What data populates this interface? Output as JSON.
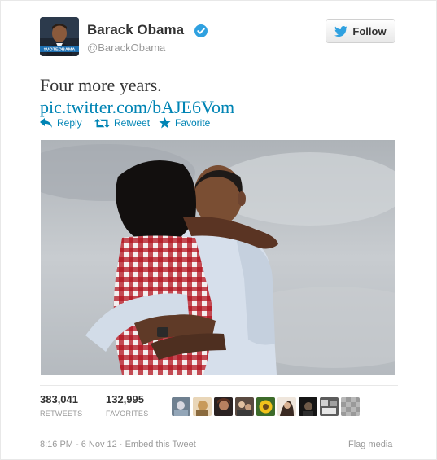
{
  "user": {
    "name": "Barack Obama",
    "handle": "@BarackObama",
    "avatar_caption": "#VOTEOBAMA",
    "verified": true
  },
  "follow": {
    "label": "Follow",
    "icon": "bird-icon"
  },
  "tweet": {
    "text": "Four more years.",
    "link": "pic.twitter.com/bAJE6Vom"
  },
  "actions": [
    {
      "label": "Reply",
      "icon": "reply-icon"
    },
    {
      "label": "Retweet",
      "icon": "retweet-icon"
    },
    {
      "label": "Favorite",
      "icon": "star-icon"
    }
  ],
  "stats": {
    "retweets_count": "383,041",
    "retweets_label": "RETWEETS",
    "favorites_count": "132,995",
    "favorites_label": "FAVORITES"
  },
  "favoriters_count": 9,
  "footer": {
    "timestamp": "8:16 PM - 6 Nov 12",
    "separator": " · ",
    "embed": "Embed this Tweet",
    "flag": "Flag media"
  },
  "colors": {
    "link": "#0084b4",
    "verified": "#2fa1e0",
    "muted": "#999999",
    "text": "#333333"
  }
}
